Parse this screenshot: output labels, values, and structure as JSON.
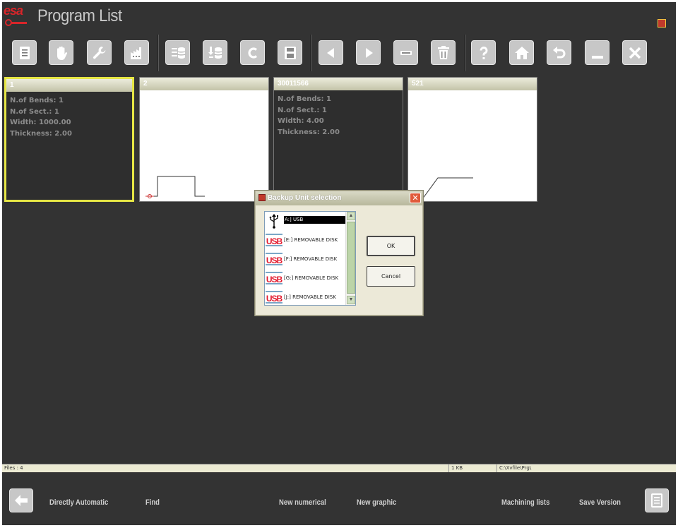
{
  "app": {
    "logo_text": "esa",
    "title": "Program List"
  },
  "toolbar": {
    "groups": [
      [
        "document-icon",
        "hand-icon",
        "wrench-icon",
        "factory-icon"
      ],
      [
        "database-list-icon",
        "database-import-icon",
        "c-icon",
        "save-disk-icon"
      ],
      [
        "arrow-left-icon",
        "arrow-right-icon",
        "minus-bar-icon",
        "trash-icon"
      ],
      [
        "help-icon",
        "home-icon",
        "undo-icon",
        "minimize-icon",
        "close-icon"
      ]
    ]
  },
  "programs": [
    {
      "name": "1",
      "info": [
        "N.of Bends: 1",
        "N.of Sect.: 1",
        "Width: 1000.00",
        "Thickness: 2.00"
      ],
      "selected": true
    },
    {
      "name": "2",
      "graphic": true
    },
    {
      "name": "30011566",
      "info": [
        "N.of Bends: 1",
        "N.of Sect.: 1",
        "Width: 4.00",
        "Thickness: 2.00"
      ]
    },
    {
      "name": "521",
      "graphic": true
    }
  ],
  "dialog": {
    "title": "Backup Unit selection",
    "drives": [
      {
        "icon": "usb-icon",
        "label": "A:] USB",
        "selected": true
      },
      {
        "icon": "usb-badge-icon",
        "badge": "USB",
        "label": "[E:] REMOVABLE DISK"
      },
      {
        "icon": "usb-badge-icon",
        "badge": "USB",
        "label": "[F:] REMOVABLE DISK"
      },
      {
        "icon": "usb-badge-icon",
        "badge": "USB",
        "label": "[G:] REMOVABLE DISK"
      },
      {
        "icon": "usb-badge-icon",
        "badge": "USB",
        "label": "[J:] REMOVABLE DISK"
      }
    ],
    "ok_label": "OK",
    "cancel_label": "Cancel"
  },
  "status": {
    "files": "Files : 4",
    "size": "1 KB",
    "path": "C:\\Xvfile\\Prg\\"
  },
  "bottom": {
    "back_icon": "arrow-back-icon",
    "actions": [
      "Directly Automatic",
      "Find",
      "New numerical",
      "New graphic",
      "Machining lists",
      "Save Version"
    ],
    "list_icon": "list-icon"
  }
}
